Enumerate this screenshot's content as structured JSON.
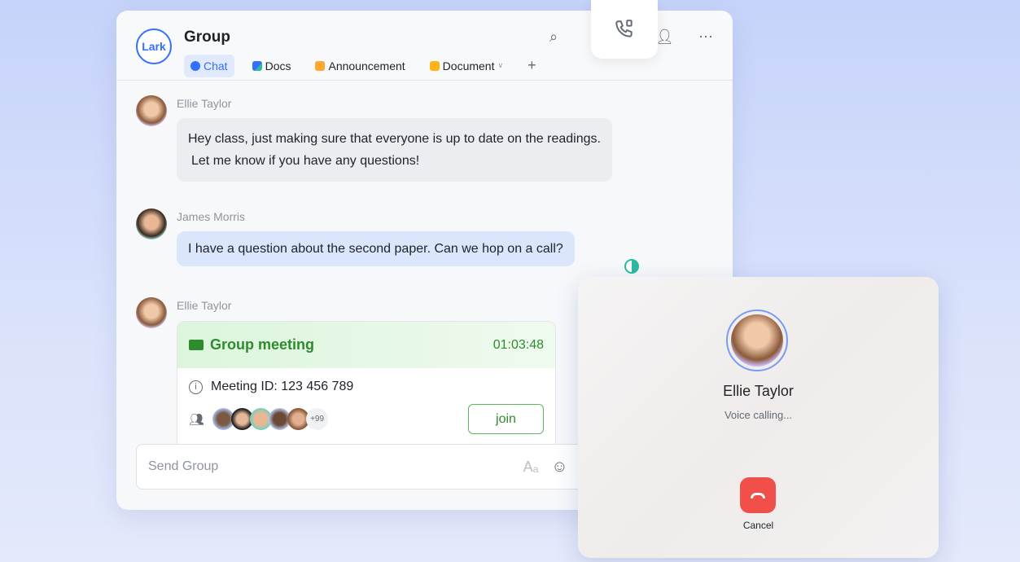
{
  "header": {
    "logo": "Lark",
    "title": "Group",
    "tabs": [
      {
        "label": "Chat",
        "icon": "chat-icon",
        "active": true
      },
      {
        "label": "Docs",
        "icon": "docs-icon"
      },
      {
        "label": "Announcement",
        "icon": "megaphone-icon"
      },
      {
        "label": "Document",
        "icon": "folder-icon"
      }
    ],
    "add_tab": "+",
    "icons": [
      "search-icon",
      "video-call-icon",
      "add-member-icon",
      "more-icon"
    ]
  },
  "messages": [
    {
      "sender": "Ellie Taylor",
      "lines": [
        "Hey class, just making sure that everyone is up to date on the readings.",
        "Let me know if you have any questions!"
      ]
    },
    {
      "sender": "James Morris",
      "text": "I have a question about the second paper. Can we hop on a call?"
    },
    {
      "sender": "Ellie Taylor"
    }
  ],
  "meeting": {
    "title": "Group meeting",
    "duration": "01:03:48",
    "meeting_id": "Meeting ID: 123 456 789",
    "extra_count": "+99",
    "join": "join"
  },
  "composer": {
    "placeholder": "Send Group"
  },
  "call": {
    "name": "Ellie Taylor",
    "status": "Voice calling...",
    "cancel": "Cancel"
  },
  "colors": {
    "accent": "#3370ff",
    "green": "#2e8b2e",
    "cancel": "#f04f4a"
  }
}
